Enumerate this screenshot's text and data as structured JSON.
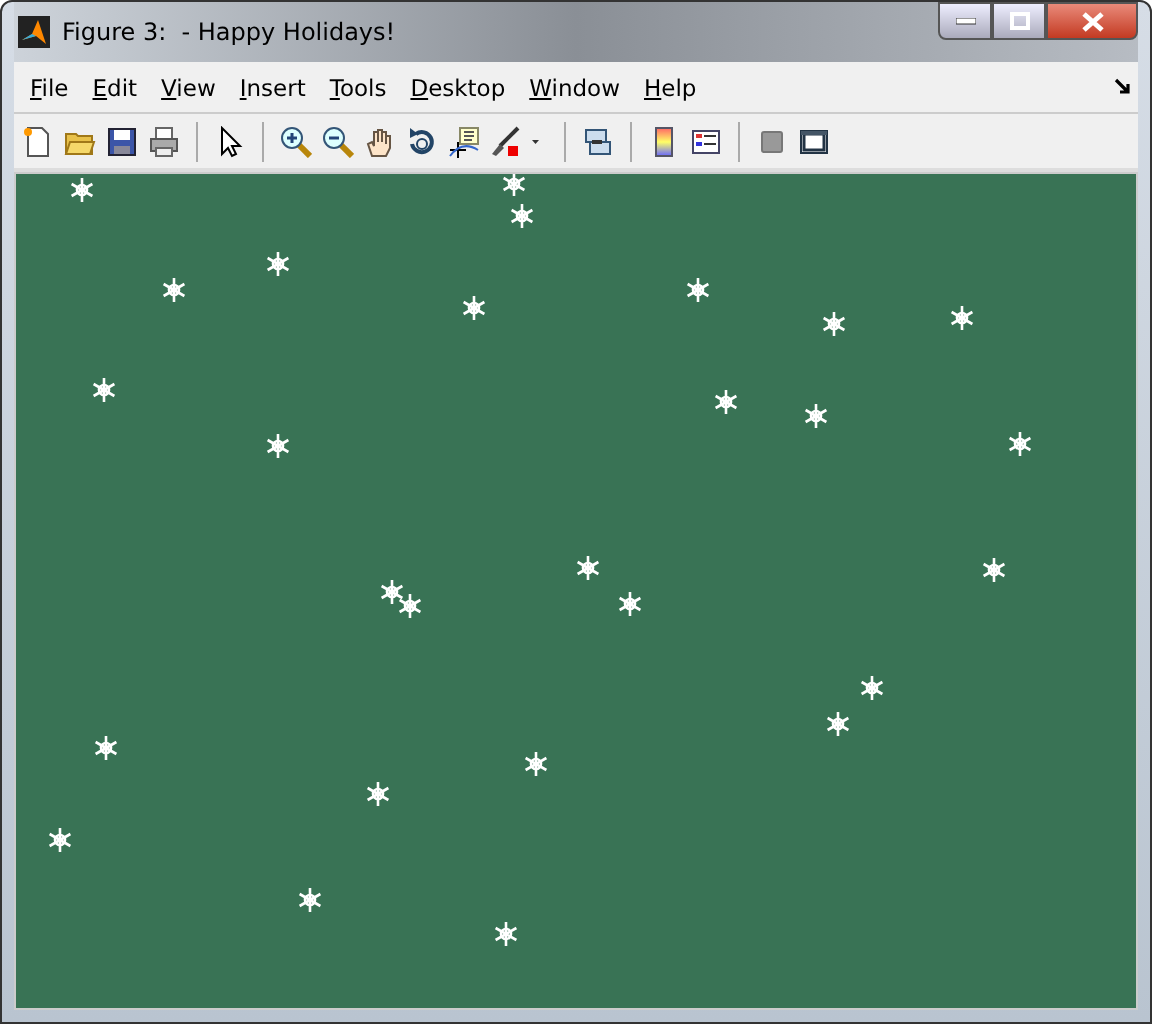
{
  "window": {
    "title": "Figure 3:  - Happy Holidays!"
  },
  "menus": [
    {
      "label": "File"
    },
    {
      "label": "Edit"
    },
    {
      "label": "View"
    },
    {
      "label": "Insert"
    },
    {
      "label": "Tools"
    },
    {
      "label": "Desktop"
    },
    {
      "label": "Window"
    },
    {
      "label": "Help"
    }
  ]
}
